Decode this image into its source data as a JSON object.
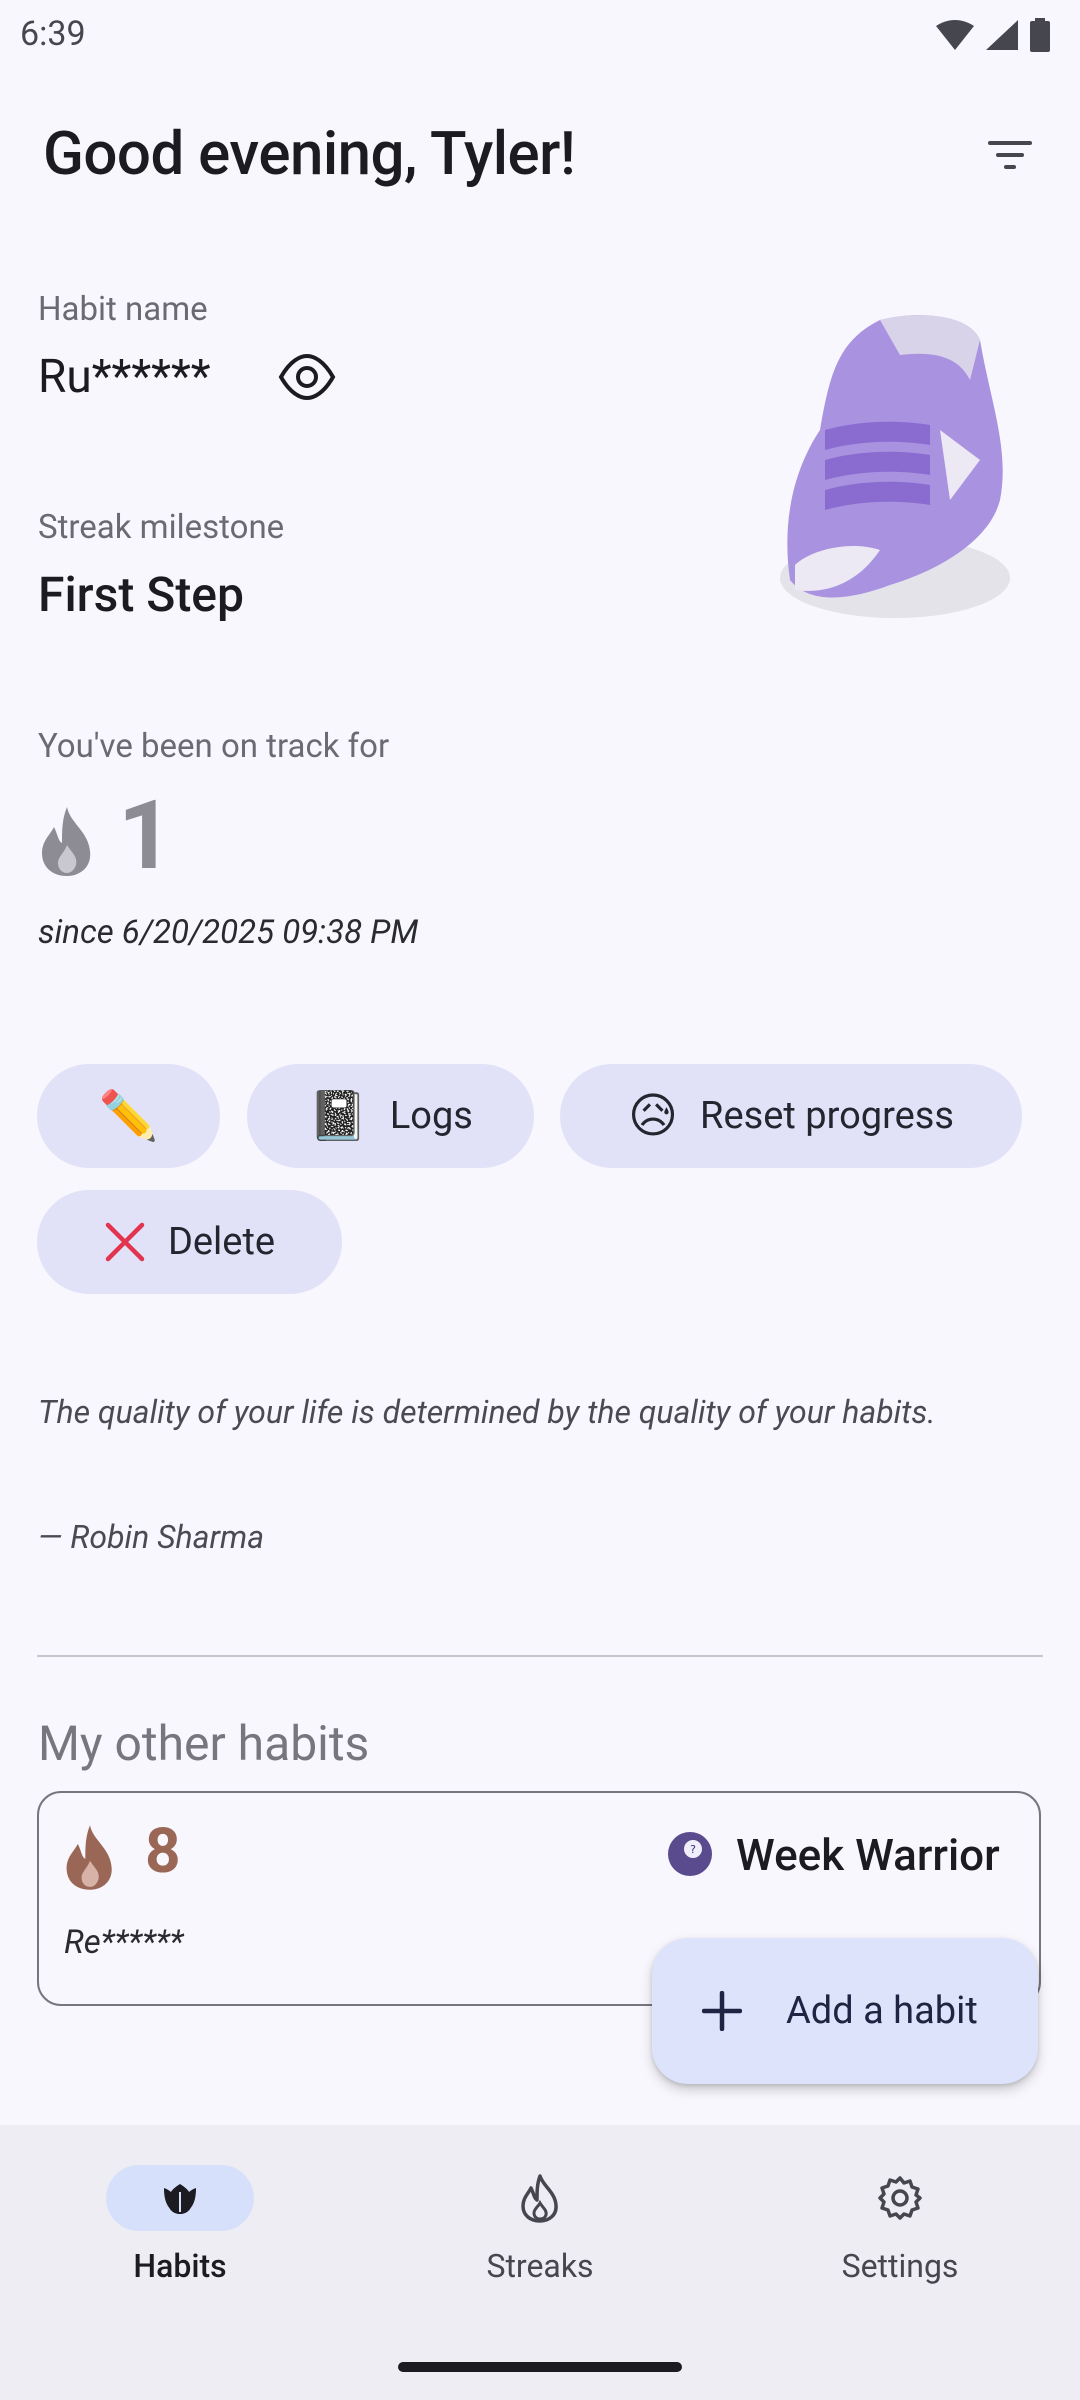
{
  "status_bar": {
    "time": "6:39"
  },
  "header": {
    "greeting": "Good evening, Tyler!"
  },
  "current_habit": {
    "name_label": "Habit name",
    "name_value": "Ru******",
    "milestone_label": "Streak milestone",
    "milestone_value": "First Step",
    "track_label": "You've been on track for",
    "streak_count": "1",
    "since": "since 6/20/2025 09:38 PM"
  },
  "actions": {
    "edit_emoji": "✏️",
    "logs_emoji": "📓",
    "logs_label": "Logs",
    "reset_emoji": "😥",
    "reset_label": "Reset progress",
    "delete_label": "Delete"
  },
  "quote": {
    "text": "The quality of your life is determined by the quality of your habits.",
    "author": "— Robin Sharma"
  },
  "other_habits": {
    "title": "My other habits",
    "items": [
      {
        "streak": "8",
        "milestone": "Week Warrior",
        "name": "Re******"
      }
    ]
  },
  "fab": {
    "label": "Add a habit"
  },
  "bottom_nav": {
    "items": [
      {
        "label": "Habits",
        "icon": "habits-icon",
        "active": true
      },
      {
        "label": "Streaks",
        "icon": "flame-icon",
        "active": false
      },
      {
        "label": "Settings",
        "icon": "gear-icon",
        "active": false
      }
    ]
  },
  "colors": {
    "background": "#f8f7fd",
    "pill": "#e1e2f8",
    "nav_active": "#d6e0fb",
    "delete_x": "#e2344f",
    "flame_current": "#8d8c95",
    "flame_other": "#9a6756"
  }
}
